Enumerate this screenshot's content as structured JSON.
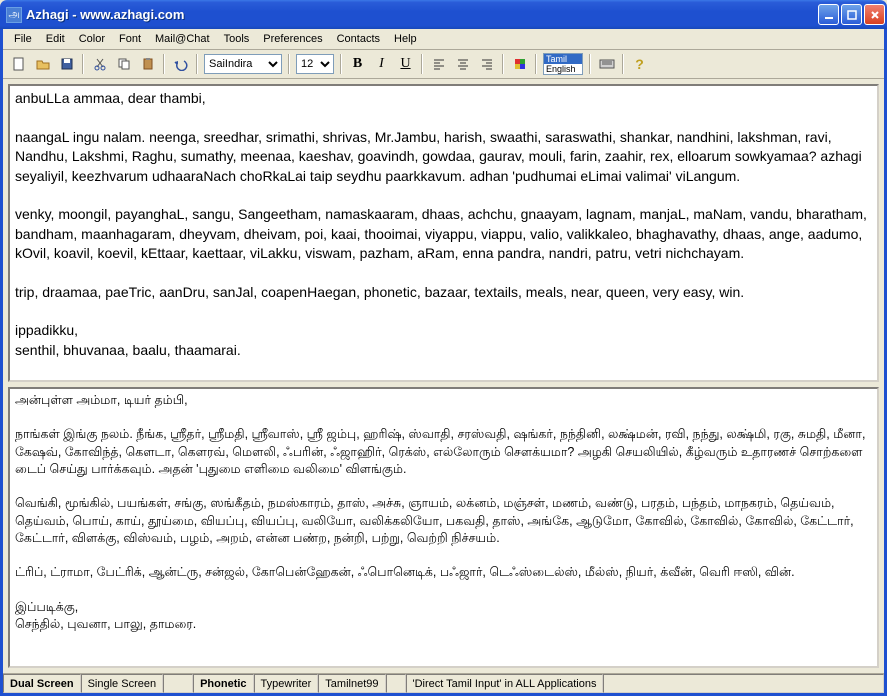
{
  "window": {
    "title": "Azhagi - www.azhagi.com"
  },
  "menu": {
    "items": [
      "File",
      "Edit",
      "Color",
      "Font",
      "Mail@Chat",
      "Tools",
      "Preferences",
      "Contacts",
      "Help"
    ]
  },
  "toolbar": {
    "font_name": "SaiIndira",
    "font_size": "12",
    "lang_tamil": "Tamil",
    "lang_english": "English"
  },
  "editor_top": "anbuLLa ammaa, dear thambi,\n\nnaangaL ingu nalam. neenga, sreedhar, srimathi, shrivas, Mr.Jambu, harish, swaathi, saraswathi, shankar, nandhini, lakshman, ravi, Nandhu, Lakshmi, Raghu, sumathy, meenaa, kaeshav, goavindh, gowdaa, gaurav, mouli, farin, zaahir, rex, elloarum sowkyamaa? azhagi seyaliyil, keezhvarum udhaaraNach choRkaLai taip seydhu paarkkavum. adhan 'pudhumai eLimai valimai' viLangum.\n\nvenky, moongil, payanghaL, sangu, Sangeetham, namaskaaram, dhaas, achchu, gnaayam, lagnam, manjaL, maNam, vandu, bharatham, bandham, maanhagaram, dheyvam, dheivam, poi, kaai, thooimai, viyappu, viappu, valio, valikkaleo, bhaghavathy, dhaas, ange, aadumo, kOvil, koavil, koevil, kEttaar, kaettaar, viLakku, viswam, pazham, aRam, enna pandra, nandri, patru, vetri nichchayam.\n\ntrip, draamaa, paeTric, aanDru, sanJal, coapenHaegan, phonetic, bazaar, textails, meals, near, queen, very easy, win.\n\nippadikku,\nsenthil, bhuvanaa, baalu, thaamarai.",
  "editor_bottom": "அன்புள்ள அம்மா, டியர் தம்பி,\n\nநாங்கள் இங்கு நலம். நீங்க, ஸ்ரீதர், ஸ்ரீமதி, ஸ்ரீவாஸ், ஸ்ரீ ஜம்பு, ஹரிஷ், ஸ்வாதி, சரஸ்வதி, ஷங்கர், நந்தினி, லக்ஷ்மன், ரவி, நந்து, லக்ஷ்மி, ரகு, சுமதி, மீனா, கேஷவ், கோவிந்த், கௌடா, கௌரவ், மௌலி, ஃபரின், ஃஜாஹிர், ரெக்ஸ், எல்லோரும் சௌக்யமா? அழகி செயலியில், கீழ்வரும் உதாரணச் சொற்களை டைப் செய்து பார்க்கவும். அதன் 'புதுமை எளிமை வலிமை' விளங்கும்.\n\nவெங்கி, மூங்கில், பயங்கள், சங்கு, ஸங்கீதம், நமஸ்காரம், தாஸ், அச்சு, ஞாயம், லக்னம், மஞ்சள், மணம், வண்டு, பரதம், பந்தம், மாநகரம், தெய்வம், தெய்வம், பொய், காய், தூய்மை, வியப்பு, வியப்பு, வலியோ, வலிக்கலியோ, பகவதி, தாஸ், அங்கே, ஆடுமோ, கோவில், கோவில், கோவில், கேட்டார், கேட்டார், விளக்கு, விஸ்வம், பழம், அறம், என்ன பண்ற, நன்றி, பற்று, வெற்றி நிச்சயம்.\n\nட்ரிப், ட்ராமா, பேட்ரிக், ஆன்ட்ரு, சன்ஜல், கோபென்ஹேகன், ஃபொனெடிக், பஃஜார், டெஃஸ்டைல்ஸ், மீல்ஸ், நியர், க்வீன், வெரி ஈஸி, வின்.\n\nஇப்படிக்கு,\nசெந்தில், புவனா, பாலு, தாமரை.",
  "status": {
    "dual": "Dual Screen",
    "single": "Single Screen",
    "phonetic": "Phonetic",
    "typewriter": "Typewriter",
    "tamilnet": "Tamilnet99",
    "direct": "'Direct Tamil Input'  in ALL  Applications"
  }
}
